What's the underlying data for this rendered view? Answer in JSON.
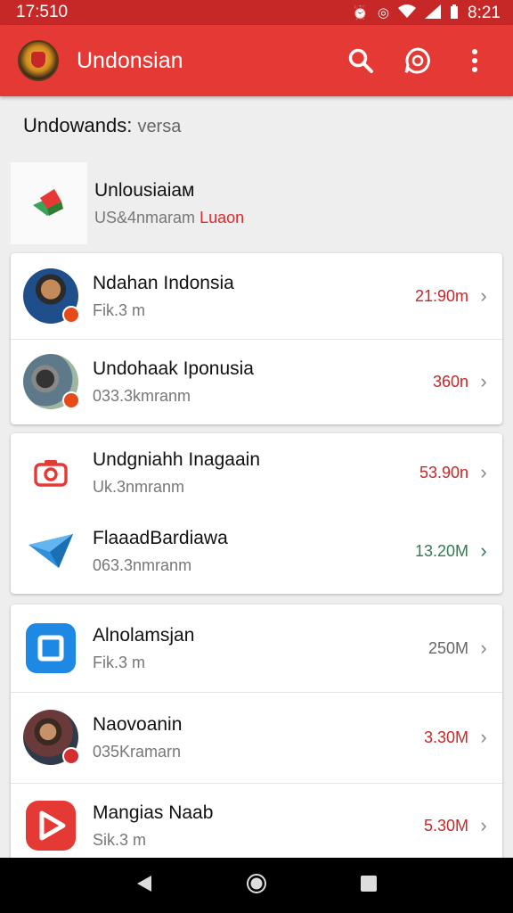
{
  "status_bar": {
    "time": "17:510",
    "right_time": "8:21"
  },
  "app_bar": {
    "title": "Undonsian"
  },
  "section": {
    "title": "Undowands:",
    "subtitle": "versa"
  },
  "featured": {
    "title": "Unlousiaiaм",
    "subtitle": "US&4nmaram",
    "highlight": "Luaon"
  },
  "cards": [
    {
      "rows": [
        {
          "title": "Ndahan Indonsia",
          "subtitle": "Fik.3 m",
          "size": "21:90m"
        },
        {
          "title": "Undohaak Iponusia",
          "subtitle": "033.3kmranm",
          "size": "360n"
        }
      ]
    },
    {
      "rows": [
        {
          "title": "Undgniahh Inagaain",
          "subtitle": "Uk.3nmranm",
          "size": "53.90n"
        },
        {
          "title": "FlaaadBardiawa",
          "subtitle": "063.3nmranm",
          "size": "13.20M"
        }
      ]
    },
    {
      "rows": [
        {
          "title": "Alnolamsjan",
          "subtitle": "Fik.3 m",
          "size": "250M"
        },
        {
          "title": "Naovoanin",
          "subtitle": "035Kramarn",
          "size": "3.30M"
        },
        {
          "title": "Mangias Naab",
          "subtitle": "Sik.3 m",
          "size": "5.30M"
        }
      ]
    }
  ],
  "colors": {
    "primary": "#e53935",
    "status_bar": "#c62828",
    "accent_red": "#c62828",
    "accent_green": "#2e7d52"
  },
  "icons": [
    "search-icon",
    "chat-icon",
    "overflow-menu-icon",
    "camera-icon",
    "send-icon",
    "square-app-icon",
    "play-icon",
    "chevron-right-icon",
    "back-icon",
    "home-icon",
    "recents-icon"
  ]
}
